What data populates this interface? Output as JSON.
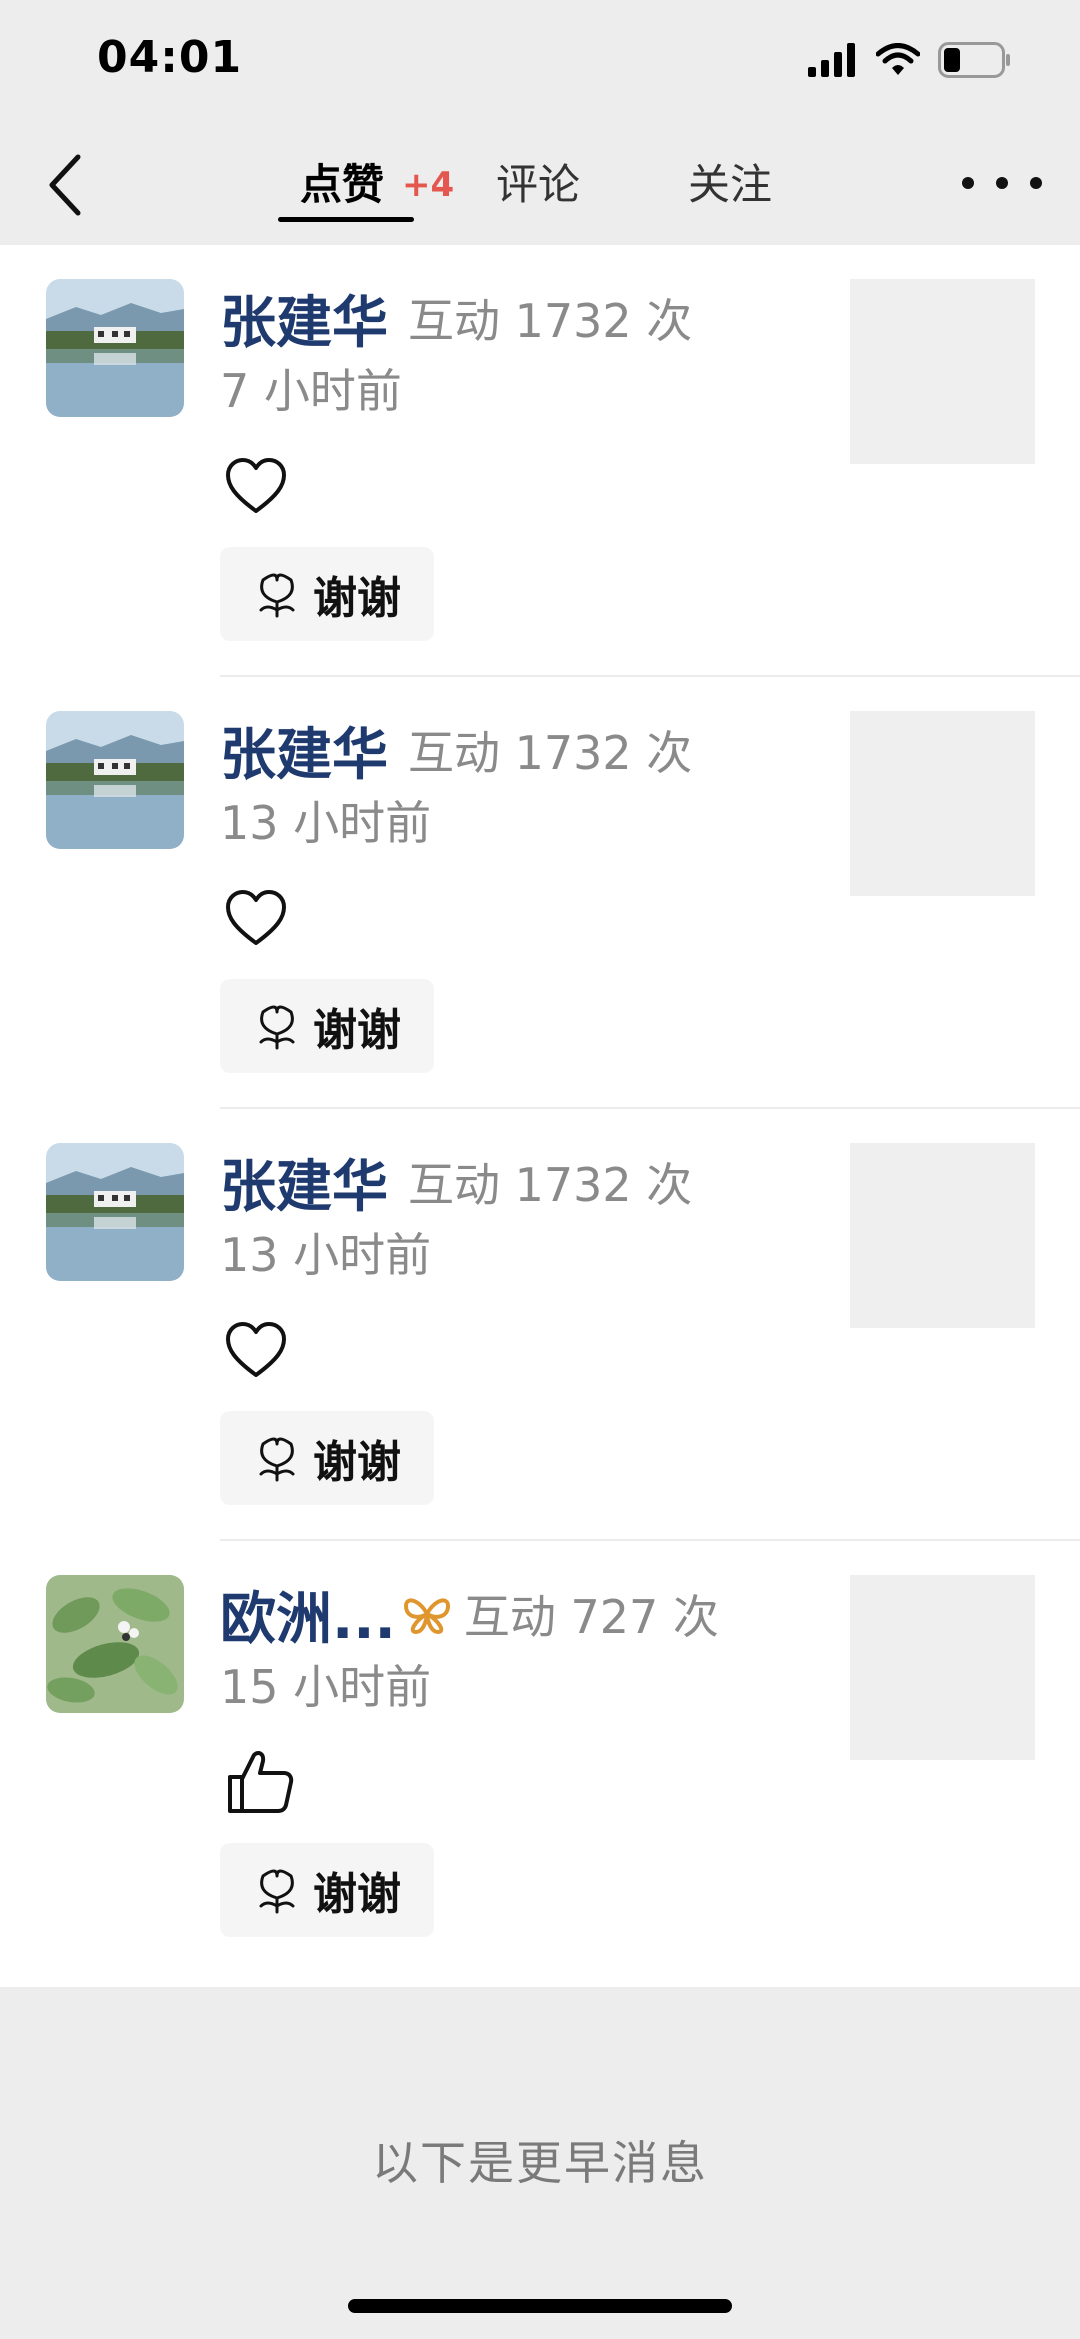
{
  "status_bar": {
    "time": "04:01"
  },
  "nav": {
    "tabs": [
      {
        "label": "点赞",
        "badge": "+4",
        "active": true
      },
      {
        "label": "评论",
        "active": false
      },
      {
        "label": "关注",
        "active": false
      }
    ],
    "back_icon": "chevron-left-icon",
    "more_icon": "ellipsis-icon"
  },
  "items": [
    {
      "name": "张建华",
      "interaction": "互动 1732 次",
      "time": "7 小时前",
      "reaction": "heart-icon",
      "thanks_label": "谢谢"
    },
    {
      "name": "张建华",
      "interaction": "互动 1732 次",
      "time": "13 小时前",
      "reaction": "heart-icon",
      "thanks_label": "谢谢"
    },
    {
      "name": "张建华",
      "interaction": "互动 1732 次",
      "time": "13 小时前",
      "reaction": "heart-icon",
      "thanks_label": "谢谢"
    },
    {
      "name": "欧洲...",
      "interaction": "互动 727 次",
      "time": "15 小时前",
      "reaction": "thumbs-up-icon",
      "thanks_label": "谢谢",
      "badge_icon": "vip-butterfly-icon"
    }
  ],
  "earlier_messages": "以下是更早消息",
  "colors": {
    "name": "#1f3a6e",
    "badge": "#e4574f",
    "vip": "#e0962e"
  }
}
